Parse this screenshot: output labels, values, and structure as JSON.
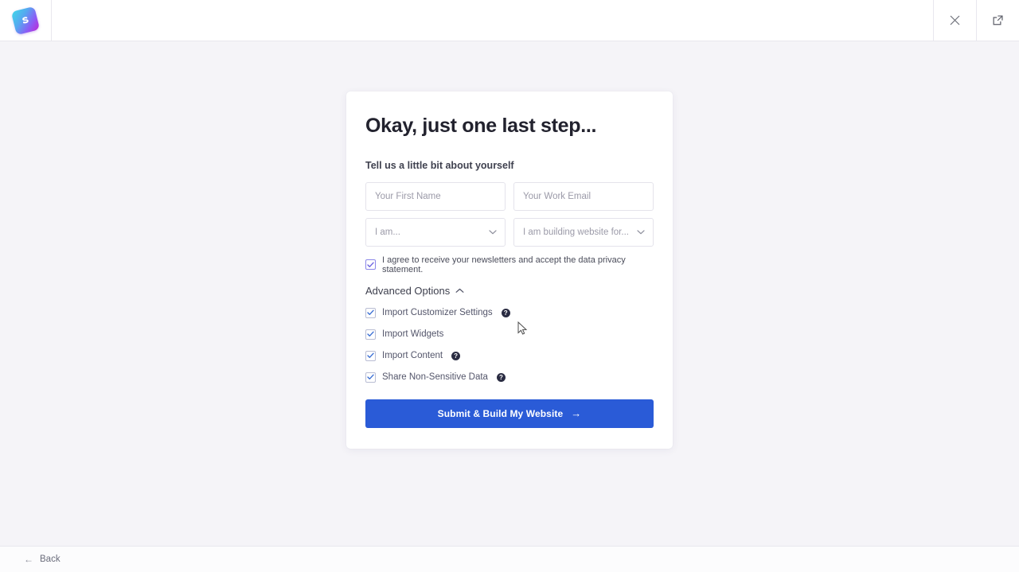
{
  "window": {
    "logo_icon": "sitepad-logo-icon",
    "close_icon": "close-icon",
    "open_external_icon": "open-external-icon"
  },
  "card": {
    "title": "Okay, just one last step...",
    "subtitle": "Tell us a little bit about yourself",
    "fields": {
      "first_name_placeholder": "Your First Name",
      "work_email_placeholder": "Your Work Email",
      "role_select_value": "I am...",
      "purpose_select_value": "I am building website for..."
    },
    "agree": {
      "label": "I agree to receive your newsletters and accept the data privacy statement.",
      "checked": "✓"
    },
    "advanced": {
      "toggle_label": "Advanced Options",
      "expanded": true,
      "options": [
        {
          "label": "Import Customizer Settings",
          "checked": "✓",
          "has_help": true,
          "help_glyph": "?"
        },
        {
          "label": "Import Widgets",
          "checked": "✓",
          "has_help": false,
          "help_glyph": ""
        },
        {
          "label": "Import Content",
          "checked": "✓",
          "has_help": true,
          "help_glyph": "?"
        },
        {
          "label": "Share Non-Sensitive Data",
          "checked": "✓",
          "has_help": true,
          "help_glyph": "?"
        }
      ]
    },
    "submit": {
      "label": "Submit & Build My Website",
      "arrow": "→"
    }
  },
  "footer": {
    "back_label": "Back",
    "back_arrow": "←"
  },
  "colors": {
    "page_background": "#f5f4f8",
    "card_background": "#ffffff",
    "primary_button": "#2a5bd7",
    "agree_checkbox_accent": "#6c63e0",
    "option_checkbox_accent": "#3b6fd4",
    "help_badge": "#2a2c42",
    "title_text": "#22222e"
  }
}
